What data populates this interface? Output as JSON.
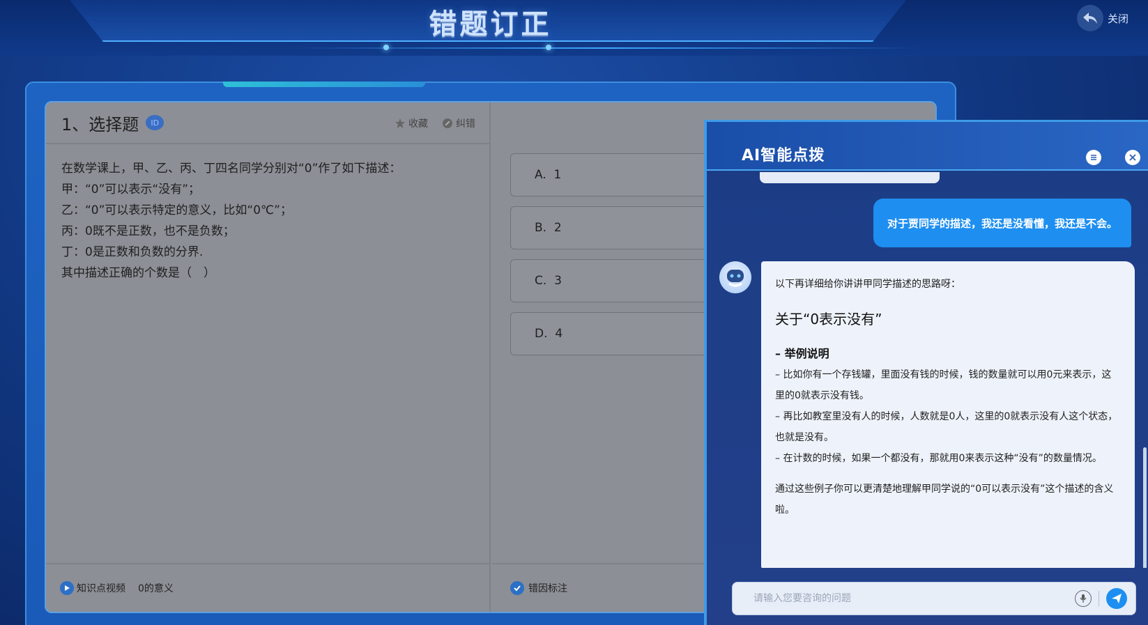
{
  "header": {
    "title": "错题订正",
    "close_label": "关闭"
  },
  "question": {
    "type_label": "1、选择题",
    "id_badge": "ID",
    "favorite_label": "收藏",
    "report_error_label": "纠错",
    "lines": [
      "在数学课上，甲、乙、丙、丁四名同学分别对“0”作了如下描述：",
      "甲：“0”可以表示“没有”；",
      "乙：“0”可以表示特定的意义，比如“0℃”；",
      "丙：0既不是正数，也不是负数；",
      "丁：0是正数和负数的分界.",
      "其中描述正确的个数是（　）"
    ],
    "options": [
      {
        "letter": "A.",
        "text": "1"
      },
      {
        "letter": "B.",
        "text": "2"
      },
      {
        "letter": "C.",
        "text": "3"
      },
      {
        "letter": "D.",
        "text": "4"
      }
    ],
    "knowledge_video_label": "知识点视频",
    "knowledge_point": "0的意义",
    "error_cause_label": "错因标注"
  },
  "ai": {
    "title": "AI智能点拨",
    "user_message": "对于贾同学的描述，我还是没看懂，我还是不会。",
    "bot_intro": "以下再详细给你讲讲甲同学描述的思路呀：",
    "bot_heading": "关于“0表示没有”",
    "bot_subheading": "– 举例说明",
    "bot_items": [
      "– 比如你有一个存钱罐，里面没有钱的时候，钱的数量就可以用0元来表示，这里的0就表示没有钱。",
      "– 再比如教室里没有人的时候，人数就是0人，这里的0就表示没有人这个状态，也就是没有。",
      "– 在计数的时候，如果一个都没有，那就用0来表示这种“没有”的数量情况。"
    ],
    "bot_conclusion": "通过这些例子你可以更清楚地理解甲同学说的“0可以表示没有”这个描述的含义啦。",
    "input_placeholder": "请输入您要咨询的问题"
  },
  "colors": {
    "accent": "#1e8ff0",
    "background": "#123a86"
  }
}
